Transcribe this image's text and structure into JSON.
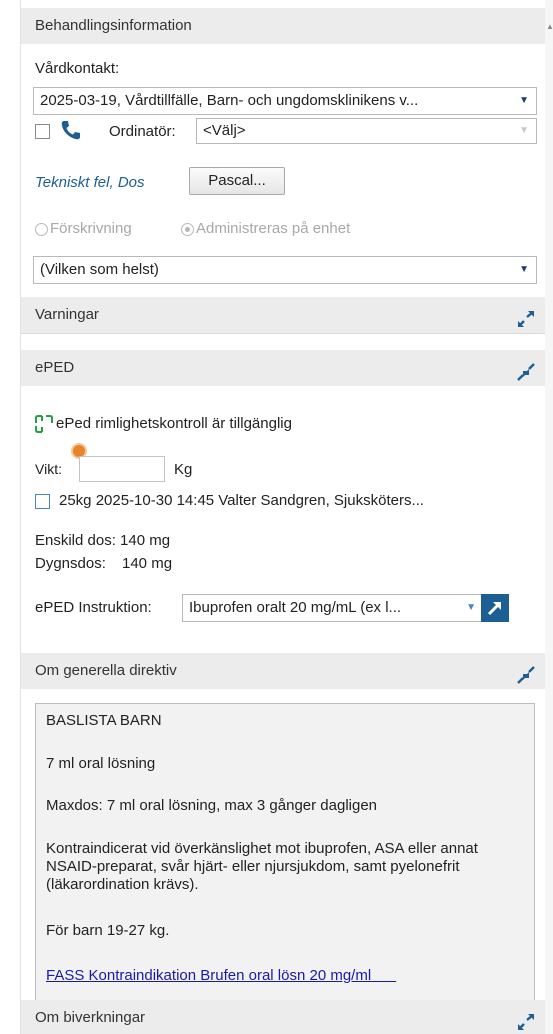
{
  "behandling": {
    "header": "Behandlingsinformation",
    "vardkontakt_label": "Vårdkontakt:",
    "vardkontakt_value": "2025-03-19, Vårdtillfälle, Barn- och ungdomsklinikens v...",
    "ordinator_label": "Ordinatör:",
    "ordinator_value": "<Välj>",
    "tekniskt_fel": "Tekniskt fel, Dos",
    "pascal_button": "Pascal...",
    "radio_forskrivning": "Förskrivning",
    "radio_administreras": "Administreras på enhet",
    "enhet_select_value": "(Vilken som helst)"
  },
  "varningar": {
    "header": "Varningar"
  },
  "eped": {
    "header": "ePED",
    "rimlighet_text": "ePed rimlighetskontroll är tillgänglig",
    "vikt_label": "Vikt:",
    "vikt_value": "",
    "vikt_unit": "Kg",
    "weight_entry": "25kg  2025-10-30 14:45  Valter Sandgren, Sjuksköters...",
    "enskild_dos": "Enskild dos: 140 mg",
    "dygnsdos_label": "Dygnsdos:",
    "dygnsdos_value": "140 mg",
    "instruktion_label": "ePED Instruktion:",
    "instruktion_value": "Ibuprofen oralt 20 mg/mL (ex l..."
  },
  "direktiv": {
    "header": "Om generella direktiv",
    "line1": "BASLISTA BARN",
    "line2": "7 ml oral lösning",
    "line3": "Maxdos: 7 ml oral lösning, max 3 gånger dagligen",
    "line4": "Kontraindicerat vid överkänslighet mot ibuprofen, ASA eller annat NSAID-preparat, svår hjärt- eller njursjukdom, samt pyelonefrit (läkarordination krävs).",
    "line5": "För barn 19-27  kg.",
    "link": "FASS Kontraindikation Brufen oral lösn 20 mg/ml"
  },
  "biverkningar": {
    "header": "Om biverkningar"
  },
  "colors": {
    "header_bg": "#ececec",
    "accent_blue": "#1d5f93",
    "link": "#1a1aa8",
    "eped_icon": "#27a043"
  }
}
